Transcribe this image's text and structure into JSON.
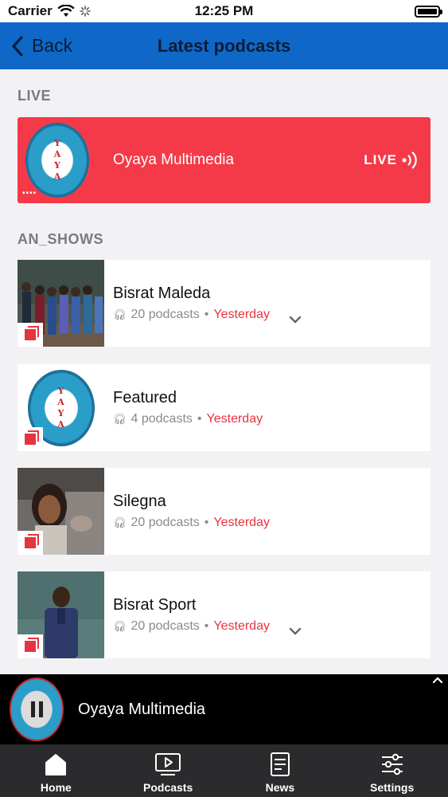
{
  "status_bar": {
    "carrier": "Carrier",
    "time": "12:25 PM"
  },
  "nav": {
    "back_label": "Back",
    "title": "Latest podcasts"
  },
  "live_section": {
    "label": "LIVE",
    "station": "Oyaya Multimedia",
    "badge": "LIVE",
    "logo_letters": [
      "Y",
      "A",
      "Y",
      "A"
    ]
  },
  "shows_section": {
    "label": "AN_SHOWS",
    "items": [
      {
        "title": "Bisrat Maleda",
        "count": "20 podcasts",
        "when": "Yesterday",
        "expandable": true
      },
      {
        "title": "Featured",
        "count": "4 podcasts",
        "when": "Yesterday",
        "expandable": false
      },
      {
        "title": "Silegna",
        "count": "20 podcasts",
        "when": "Yesterday",
        "expandable": false
      },
      {
        "title": "Bisrat Sport",
        "count": "20 podcasts",
        "when": "Yesterday",
        "expandable": true
      }
    ]
  },
  "player": {
    "title": "Oyaya Multimedia",
    "state": "playing"
  },
  "tabs": [
    {
      "label": "Home",
      "icon": "home-icon"
    },
    {
      "label": "Podcasts",
      "icon": "podcasts-icon"
    },
    {
      "label": "News",
      "icon": "news-icon"
    },
    {
      "label": "Settings",
      "icon": "settings-icon"
    }
  ],
  "colors": {
    "nav_blue": "#0f67c8",
    "live_red": "#f43a48",
    "accent_red": "#e63340",
    "tab_bar": "#2b2b2d"
  }
}
